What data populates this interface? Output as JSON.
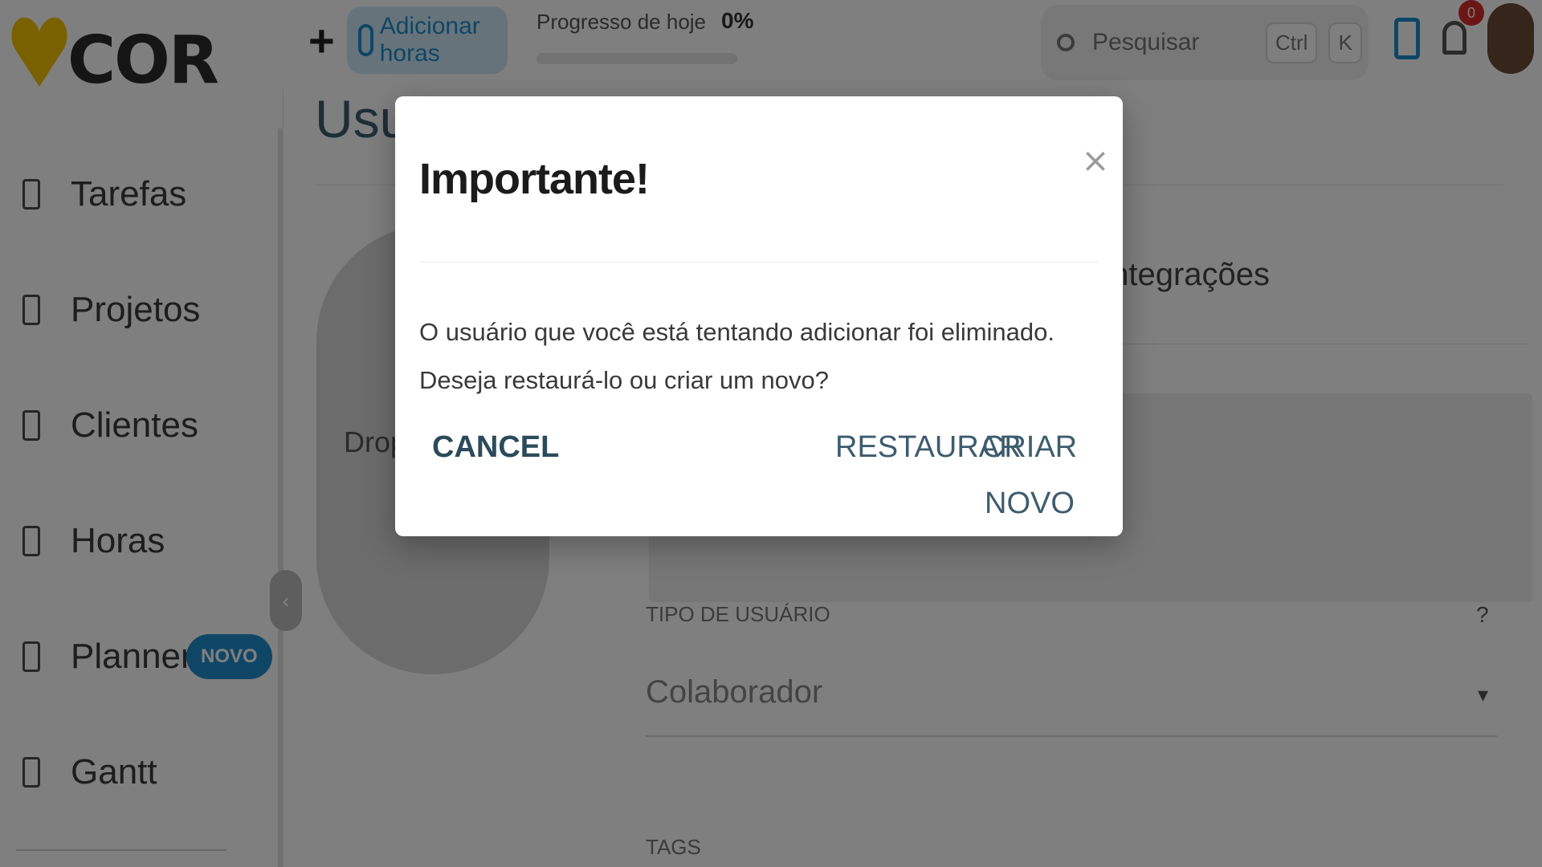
{
  "app": {
    "logo_text": "COR",
    "brand_color": "#f2c200",
    "accent_color": "#1e8dcc"
  },
  "sidebar": {
    "items": [
      {
        "label": "Tarefas",
        "icon": "tasks-icon"
      },
      {
        "label": "Projetos",
        "icon": "projects-icon"
      },
      {
        "label": "Clientes",
        "icon": "clients-icon"
      },
      {
        "label": "Horas",
        "icon": "hourglass-icon"
      },
      {
        "label": "Planner",
        "icon": "planner-icon",
        "badge": "NOVO"
      },
      {
        "label": "Gantt",
        "icon": "gantt-icon"
      }
    ]
  },
  "topbar": {
    "add_hours_label": "Adicionar horas",
    "progress_label": "Progresso de hoje",
    "progress_value": "0%",
    "progress_fraction": 0,
    "search_placeholder": "Pesquisar",
    "shortcut_keys": [
      "Ctrl",
      "K"
    ],
    "notification_count": "0"
  },
  "main": {
    "page_title": "Usuá",
    "photo_drop_text": "Drop y",
    "tab_integracoes": "Integrações",
    "user_type_label": "TIPO DE USUÁRIO",
    "user_type_help": "?",
    "user_type_value": "Colaborador",
    "tags_label": "TAGS"
  },
  "modal": {
    "title": "Importante!",
    "close_glyph": "×",
    "message": "O usuário que você está tentando adicionar foi eliminado. Deseja restaurá-lo ou criar um novo?",
    "cancel_label": "CANCEL",
    "restore_label": "RESTAURAR",
    "create_label": "CRIAR NOVO"
  }
}
